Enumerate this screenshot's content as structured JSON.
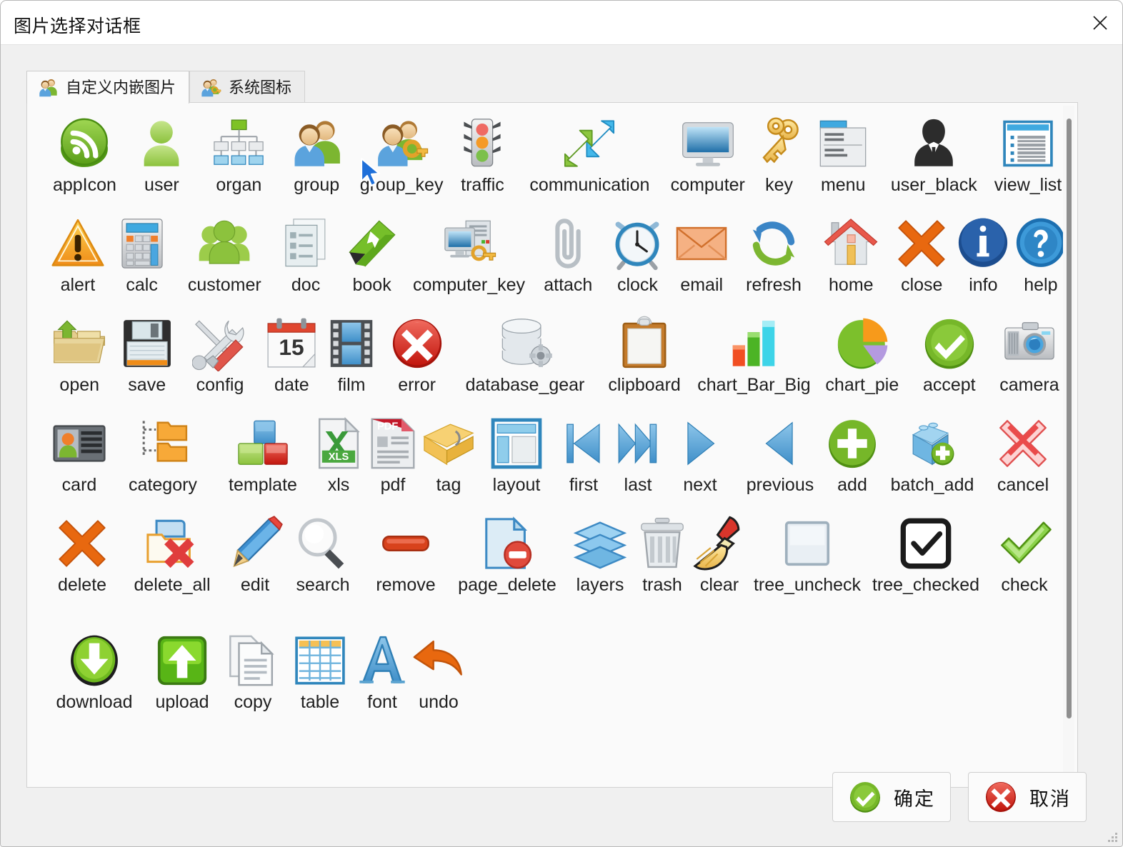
{
  "window": {
    "title": "图片选择对话框",
    "close_icon": "close-x-icon"
  },
  "tabs": [
    {
      "label": "自定义内嵌图片",
      "icon": "group-users-icon",
      "active": true
    },
    {
      "label": "系统图标",
      "icon": "group-key-icon",
      "active": false
    }
  ],
  "icon_grid": {
    "rows": [
      [
        {
          "name": "appIcon",
          "icon": "rss-globe-icon"
        },
        {
          "name": "user",
          "icon": "user-icon"
        },
        {
          "name": "organ",
          "icon": "org-chart-icon"
        },
        {
          "name": "group",
          "icon": "group-icon"
        },
        {
          "name": "group_key",
          "icon": "group-key-icon"
        },
        {
          "name": "traffic",
          "icon": "traffic-light-icon"
        },
        {
          "name": "communication",
          "icon": "two-arrows-icon"
        },
        {
          "name": "computer",
          "icon": "monitor-icon"
        },
        {
          "name": "key",
          "icon": "keys-icon"
        },
        {
          "name": "menu",
          "icon": "menu-list-icon"
        },
        {
          "name": "user_black",
          "icon": "user-black-icon"
        },
        {
          "name": "view_list",
          "icon": "view-list-icon"
        }
      ],
      [
        {
          "name": "alert",
          "icon": "warning-triangle-icon"
        },
        {
          "name": "calc",
          "icon": "calculator-icon"
        },
        {
          "name": "customer",
          "icon": "customers-icon"
        },
        {
          "name": "doc",
          "icon": "document-icon"
        },
        {
          "name": "book",
          "icon": "book-icon"
        },
        {
          "name": "computer_key",
          "icon": "computer-key-icon"
        },
        {
          "name": "attach",
          "icon": "paperclip-icon"
        },
        {
          "name": "clock",
          "icon": "alarm-clock-icon"
        },
        {
          "name": "email",
          "icon": "envelope-icon"
        },
        {
          "name": "refresh",
          "icon": "refresh-arrows-icon"
        },
        {
          "name": "home",
          "icon": "house-icon"
        },
        {
          "name": "close",
          "icon": "orange-x-icon"
        },
        {
          "name": "info",
          "icon": "info-circle-icon"
        },
        {
          "name": "help",
          "icon": "question-circle-icon"
        }
      ],
      [
        {
          "name": "open",
          "icon": "open-folder-icon"
        },
        {
          "name": "save",
          "icon": "floppy-disk-icon"
        },
        {
          "name": "config",
          "icon": "tools-icon"
        },
        {
          "name": "date",
          "icon": "calendar-icon"
        },
        {
          "name": "film",
          "icon": "film-strip-icon"
        },
        {
          "name": "error",
          "icon": "error-circle-icon"
        },
        {
          "name": "database_gear",
          "icon": "database-gear-icon"
        },
        {
          "name": "clipboard",
          "icon": "clipboard-icon"
        },
        {
          "name": "chart_Bar_Big",
          "icon": "bar-chart-icon"
        },
        {
          "name": "chart_pie",
          "icon": "pie-chart-icon"
        },
        {
          "name": "accept",
          "icon": "accept-check-icon"
        },
        {
          "name": "camera",
          "icon": "camera-icon"
        }
      ],
      [
        {
          "name": "card",
          "icon": "id-card-icon"
        },
        {
          "name": "category",
          "icon": "folder-tree-icon"
        },
        {
          "name": "template",
          "icon": "blocks-icon"
        },
        {
          "name": "xls",
          "icon": "xls-file-icon"
        },
        {
          "name": "pdf",
          "icon": "pdf-file-icon"
        },
        {
          "name": "tag",
          "icon": "tag-icon"
        },
        {
          "name": "layout",
          "icon": "layout-icon"
        },
        {
          "name": "first",
          "icon": "first-arrow-icon"
        },
        {
          "name": "last",
          "icon": "last-arrow-icon"
        },
        {
          "name": "next",
          "icon": "next-arrow-icon"
        },
        {
          "name": "previous",
          "icon": "previous-arrow-icon"
        },
        {
          "name": "add",
          "icon": "add-plus-icon"
        },
        {
          "name": "batch_add",
          "icon": "batch-add-icon"
        },
        {
          "name": "cancel",
          "icon": "red-x-icon"
        }
      ],
      [
        {
          "name": "delete",
          "icon": "orange-x-icon"
        },
        {
          "name": "delete_all",
          "icon": "folder-delete-icon"
        },
        {
          "name": "edit",
          "icon": "pencil-icon"
        },
        {
          "name": "search",
          "icon": "magnifier-icon"
        },
        {
          "name": "remove",
          "icon": "minus-bar-icon"
        },
        {
          "name": "page_delete",
          "icon": "page-delete-icon"
        },
        {
          "name": "layers",
          "icon": "layers-icon"
        },
        {
          "name": "trash",
          "icon": "trash-can-icon"
        },
        {
          "name": "clear",
          "icon": "broom-icon"
        },
        {
          "name": "tree_uncheck",
          "icon": "empty-checkbox-icon"
        },
        {
          "name": "tree_checked",
          "icon": "checked-box-icon"
        },
        {
          "name": "check",
          "icon": "green-check-icon"
        }
      ],
      [
        {
          "name": "download",
          "icon": "download-circle-icon"
        },
        {
          "name": "upload",
          "icon": "upload-square-icon"
        },
        {
          "name": "copy",
          "icon": "copy-pages-icon"
        },
        {
          "name": "table",
          "icon": "table-grid-icon"
        },
        {
          "name": "font",
          "icon": "font-a-icon"
        },
        {
          "name": "undo",
          "icon": "undo-arrow-icon"
        }
      ]
    ]
  },
  "footer": {
    "ok_label": "确定",
    "ok_icon": "accept-check-icon",
    "cancel_label": "取消",
    "cancel_icon": "error-circle-icon"
  },
  "colors": {
    "accent_green": "#76b729",
    "accent_red": "#d32b1e",
    "accent_orange": "#e8680f",
    "accent_blue": "#1e88cf",
    "panel_bg": "#fafafa",
    "dialog_bg": "#f0f0f0"
  }
}
